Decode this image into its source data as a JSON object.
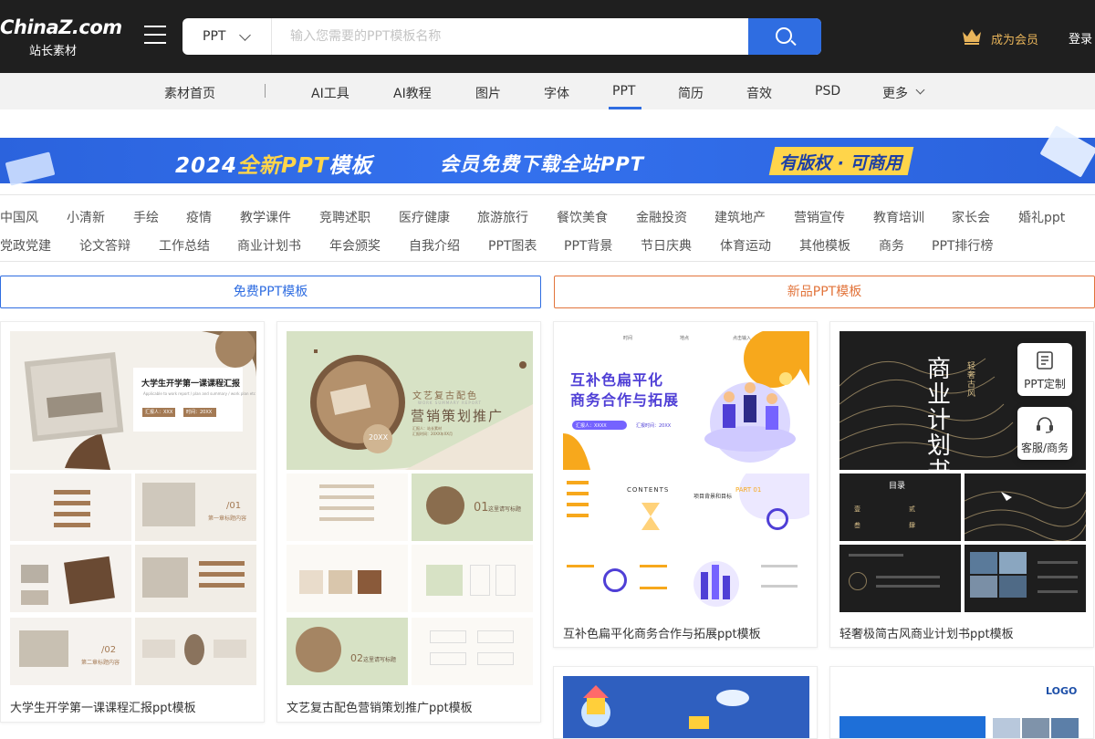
{
  "header": {
    "logo_main": "ChinaZ.com",
    "logo_sub": "站长素材",
    "search": {
      "category": "PPT",
      "placeholder": "输入您需要的PPT模板名称"
    },
    "vip_label": "成为会员",
    "login_label": "登录"
  },
  "subnav": {
    "items": [
      "素材首页",
      "AI工具",
      "AI教程",
      "图片",
      "字体",
      "PPT",
      "简历",
      "音效",
      "PSD",
      "更多"
    ],
    "active": "PPT"
  },
  "banner": {
    "title_a": "2024",
    "title_b": "全新PPT",
    "title_c": "模板",
    "subtitle": "会员免费下载全站PPT",
    "tag": "有版权 · 可商用"
  },
  "tags_row1": [
    "中国风",
    "小清新",
    "手绘",
    "疫情",
    "教学课件",
    "竞聘述职",
    "医疗健康",
    "旅游旅行",
    "餐饮美食",
    "金融投资",
    "建筑地产",
    "营销宣传",
    "教育培训",
    "家长会",
    "婚礼ppt"
  ],
  "tags_row2": [
    "党政党建",
    "论文答辩",
    "工作总结",
    "商业计划书",
    "年会颁奖",
    "自我介绍",
    "PPT图表",
    "PPT背景",
    "节日庆典",
    "体育运动",
    "其他模板",
    "商务",
    "PPT排行榜"
  ],
  "tabs": {
    "free": "免费PPT模板",
    "new": "新品PPT模板"
  },
  "cards": [
    {
      "title": "大学生开学第一课课程汇报ppt模板",
      "cover_heading": "大学生开学第一课课程汇报",
      "cover_sub": "Applicable to work report / plan and summary / work plan etc",
      "cover_tags": [
        "汇报人：XXX",
        "时间：20XX"
      ],
      "slide_labels": [
        "/01",
        "第一章标题内容",
        "/02",
        "第二章标题内容"
      ]
    },
    {
      "title": "文艺复古配色营销策划推广ppt模板",
      "cover_heading_1": "文艺复古配色",
      "cover_heading_2": "营销策划推广",
      "cover_sub": "WORK SUMMARY REPORT",
      "cover_meta": [
        "汇报人：站长素材",
        "汇报时间：20XX年XX月"
      ],
      "cover_badge": "20XX",
      "slide_labels": [
        "01",
        "这里请写标题",
        "02",
        "这里请写标题"
      ]
    },
    {
      "title": "互补色扁平化商务合作与拓展ppt模板",
      "cover_heading_1": "互补色扁平化",
      "cover_heading_2": "商务合作与拓展",
      "cover_meta": [
        "汇报人：XXXX",
        "汇报时间：20XX"
      ],
      "top_labels": [
        "时间",
        "地点",
        "点击输入"
      ],
      "slide_labels": [
        "CONTENTS",
        "PART 01",
        "项目背景和目标"
      ]
    },
    {
      "title": "轻奢极简古风商业计划书ppt模板",
      "cover_heading": "商业计划书",
      "cover_side": "轻奢古风",
      "slide_labels": [
        "目录",
        "壹",
        "贰",
        "叁",
        "肆"
      ]
    }
  ],
  "side_buttons": [
    "PPT定制",
    "客服/商务"
  ],
  "bottom_cards": {
    "logo_text": "LOGO"
  },
  "colors": {
    "header_bg": "#1f1f1f",
    "accent_blue": "#2f6de1",
    "accent_orange": "#e2743b",
    "vip_gold": "#e8b45a",
    "banner_yellow": "#ffd54a"
  }
}
